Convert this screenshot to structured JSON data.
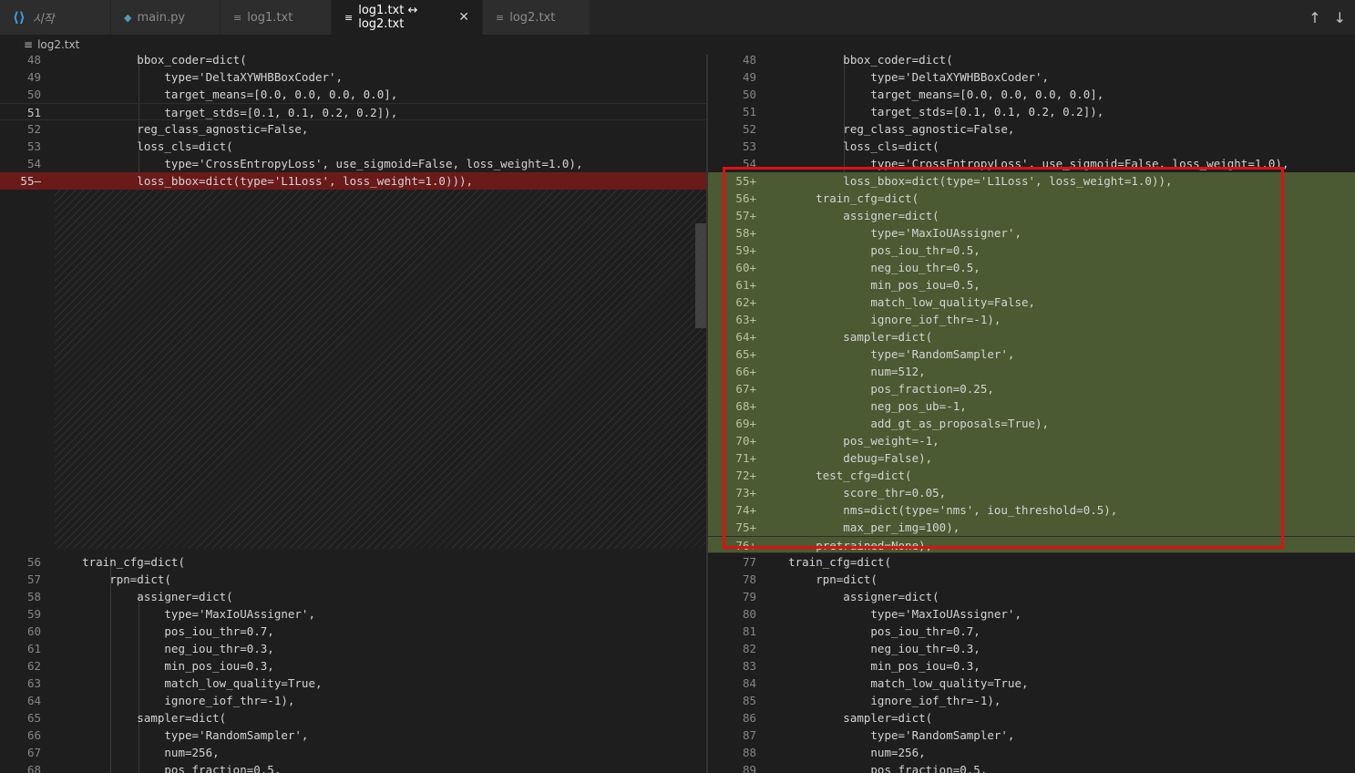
{
  "tabs": [
    {
      "label": "시작",
      "icon": "vscode-icon"
    },
    {
      "label": "main.py",
      "icon": "python-icon"
    },
    {
      "label": "log1.txt",
      "icon": "text-file-icon"
    },
    {
      "label": "log1.txt ↔ log2.txt",
      "icon": "text-file-icon",
      "active": true,
      "close": "✕"
    },
    {
      "label": "log2.txt",
      "icon": "text-file-icon"
    }
  ],
  "nav": {
    "up_icon": "arrow-up-icon",
    "down_icon": "arrow-down-icon"
  },
  "breadcrumb": {
    "file": "log2.txt"
  },
  "colors": {
    "removed_bg": "#6b1a1a",
    "added_bg": "#4b5a32",
    "highlight_border": "#e01010"
  },
  "left": {
    "top_lines": [
      {
        "n": "48",
        "code": "            bbox_coder=dict("
      },
      {
        "n": "49",
        "code": "                type='DeltaXYWHBBoxCoder',"
      },
      {
        "n": "50",
        "code": "                target_means=[0.0, 0.0, 0.0, 0.0],"
      },
      {
        "n": "51",
        "code": "                target_stds=[0.1, 0.1, 0.2, 0.2]),",
        "current": true
      },
      {
        "n": "52",
        "code": "            reg_class_agnostic=False,"
      },
      {
        "n": "53",
        "code": "            loss_cls=dict("
      },
      {
        "n": "54",
        "code": "                type='CrossEntropyLoss', use_sigmoid=False, loss_weight=1.0),"
      },
      {
        "n": "55—",
        "code": "            loss_bbox=dict(type='L1Loss', loss_weight=1.0))),",
        "type": "removed"
      }
    ],
    "bottom_lines": [
      {
        "n": "56",
        "code": "    train_cfg=dict("
      },
      {
        "n": "57",
        "code": "        rpn=dict("
      },
      {
        "n": "58",
        "code": "            assigner=dict("
      },
      {
        "n": "59",
        "code": "                type='MaxIoUAssigner',"
      },
      {
        "n": "60",
        "code": "                pos_iou_thr=0.7,"
      },
      {
        "n": "61",
        "code": "                neg_iou_thr=0.3,"
      },
      {
        "n": "62",
        "code": "                min_pos_iou=0.3,"
      },
      {
        "n": "63",
        "code": "                match_low_quality=True,"
      },
      {
        "n": "64",
        "code": "                ignore_iof_thr=-1),"
      },
      {
        "n": "65",
        "code": "            sampler=dict("
      },
      {
        "n": "66",
        "code": "                type='RandomSampler',"
      },
      {
        "n": "67",
        "code": "                num=256,"
      },
      {
        "n": "68",
        "code": "                pos_fraction=0.5,"
      }
    ]
  },
  "right": {
    "lines": [
      {
        "n": "48",
        "code": "            bbox_coder=dict("
      },
      {
        "n": "49",
        "code": "                type='DeltaXYWHBBoxCoder',"
      },
      {
        "n": "50",
        "code": "                target_means=[0.0, 0.0, 0.0, 0.0],"
      },
      {
        "n": "51",
        "code": "                target_stds=[0.1, 0.1, 0.2, 0.2]),"
      },
      {
        "n": "52",
        "code": "            reg_class_agnostic=False,"
      },
      {
        "n": "53",
        "code": "            loss_cls=dict("
      },
      {
        "n": "54",
        "code": "                type='CrossEntropyLoss', use_sigmoid=False, loss_weight=1.0),"
      },
      {
        "n": "55+",
        "code": "            loss_bbox=dict(type='L1Loss', loss_weight=1.0)),",
        "type": "added"
      },
      {
        "n": "56+",
        "code": "        train_cfg=dict(",
        "type": "added"
      },
      {
        "n": "57+",
        "code": "            assigner=dict(",
        "type": "added"
      },
      {
        "n": "58+",
        "code": "                type='MaxIoUAssigner',",
        "type": "added"
      },
      {
        "n": "59+",
        "code": "                pos_iou_thr=0.5,",
        "type": "added"
      },
      {
        "n": "60+",
        "code": "                neg_iou_thr=0.5,",
        "type": "added"
      },
      {
        "n": "61+",
        "code": "                min_pos_iou=0.5,",
        "type": "added"
      },
      {
        "n": "62+",
        "code": "                match_low_quality=False,",
        "type": "added"
      },
      {
        "n": "63+",
        "code": "                ignore_iof_thr=-1),",
        "type": "added"
      },
      {
        "n": "64+",
        "code": "            sampler=dict(",
        "type": "added"
      },
      {
        "n": "65+",
        "code": "                type='RandomSampler',",
        "type": "added"
      },
      {
        "n": "66+",
        "code": "                num=512,",
        "type": "added"
      },
      {
        "n": "67+",
        "code": "                pos_fraction=0.25,",
        "type": "added"
      },
      {
        "n": "68+",
        "code": "                neg_pos_ub=-1,",
        "type": "added"
      },
      {
        "n": "69+",
        "code": "                add_gt_as_proposals=True),",
        "type": "added"
      },
      {
        "n": "70+",
        "code": "            pos_weight=-1,",
        "type": "added"
      },
      {
        "n": "71+",
        "code": "            debug=False),",
        "type": "added"
      },
      {
        "n": "72+",
        "code": "        test_cfg=dict(",
        "type": "added"
      },
      {
        "n": "73+",
        "code": "            score_thr=0.05,",
        "type": "added"
      },
      {
        "n": "74+",
        "code": "            nms=dict(type='nms', iou_threshold=0.5),",
        "type": "added"
      },
      {
        "n": "75+",
        "code": "            max_per_img=100),",
        "type": "added"
      },
      {
        "n": "76+",
        "code": "        pretrained=None),",
        "type": "added",
        "current": true
      },
      {
        "n": "77",
        "code": "    train_cfg=dict("
      },
      {
        "n": "78",
        "code": "        rpn=dict("
      },
      {
        "n": "79",
        "code": "            assigner=dict("
      },
      {
        "n": "80",
        "code": "                type='MaxIoUAssigner',"
      },
      {
        "n": "81",
        "code": "                pos_iou_thr=0.7,"
      },
      {
        "n": "82",
        "code": "                neg_iou_thr=0.3,"
      },
      {
        "n": "83",
        "code": "                min_pos_iou=0.3,"
      },
      {
        "n": "84",
        "code": "                match_low_quality=True,"
      },
      {
        "n": "85",
        "code": "                ignore_iof_thr=-1),"
      },
      {
        "n": "86",
        "code": "            sampler=dict("
      },
      {
        "n": "87",
        "code": "                type='RandomSampler',"
      },
      {
        "n": "88",
        "code": "                num=256,"
      },
      {
        "n": "89",
        "code": "                pos_fraction=0.5,"
      }
    ]
  }
}
